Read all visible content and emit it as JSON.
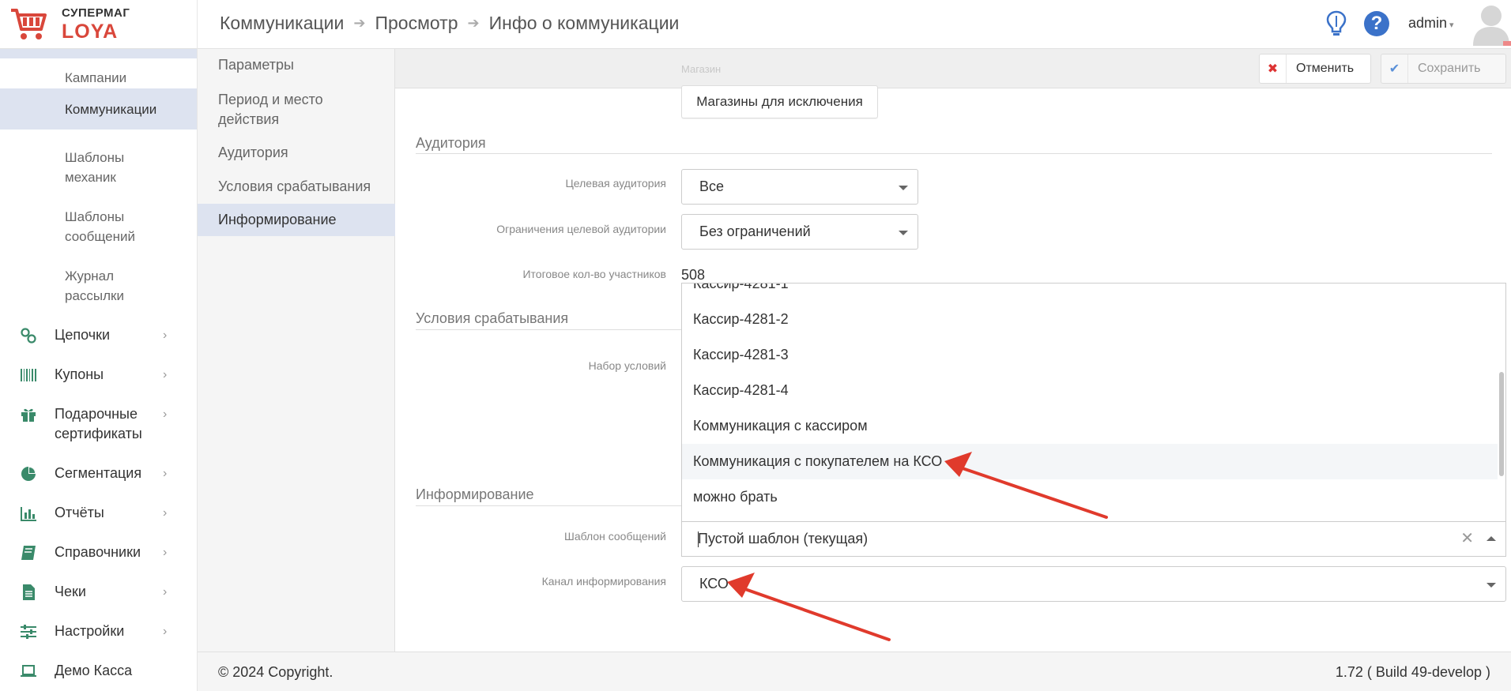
{
  "logo": {
    "top": "СУПЕРМАГ",
    "bottom": "LOYA"
  },
  "breadcrumb": {
    "items": [
      "Коммуникации",
      "Просмотр",
      "Инфо о коммуникации"
    ],
    "separator": "➔"
  },
  "header": {
    "user": "admin",
    "help_glyph": "?"
  },
  "sidebar": {
    "sub_items": [
      {
        "label": "Кампании"
      },
      {
        "label": "Коммуникации"
      },
      {
        "label": "Шаблоны механик"
      },
      {
        "label": "Шаблоны сообщений"
      },
      {
        "label": "Журнал рассылки"
      }
    ],
    "nav_items": [
      {
        "label": "Цепочки",
        "icon": "chain-icon"
      },
      {
        "label": "Купоны",
        "icon": "barcode-icon"
      },
      {
        "label": "Подарочные сертификаты",
        "icon": "gift-icon"
      },
      {
        "label": "Сегментация",
        "icon": "pie-chart-icon"
      },
      {
        "label": "Отчёты",
        "icon": "bar-chart-icon"
      },
      {
        "label": "Справочники",
        "icon": "book-icon"
      },
      {
        "label": "Чеки",
        "icon": "receipt-icon"
      },
      {
        "label": "Настройки",
        "icon": "sliders-icon"
      },
      {
        "label": "Демо Касса",
        "icon": "laptop-icon"
      }
    ],
    "chevron": "›"
  },
  "submenu": {
    "items": [
      {
        "label": "Параметры"
      },
      {
        "label": "Период и место действия"
      },
      {
        "label": "Аудитория"
      },
      {
        "label": "Условия срабатывания"
      },
      {
        "label": "Информирование"
      }
    ]
  },
  "toolbar": {
    "faded_text": "Магазин",
    "cancel_label": "Отменить",
    "save_label": "Сохранить",
    "cancel_glyph": "✖",
    "save_glyph": "✔"
  },
  "form": {
    "exclude_stores_button": "Магазины для исключения",
    "sections": {
      "audience": "Аудитория",
      "conditions": "Условия срабатывания",
      "informing": "Информирование"
    },
    "labels": {
      "target_audience": "Целевая аудитория",
      "audience_limits": "Ограничения целевой аудитории",
      "total_participants": "Итоговое кол-во участников",
      "conditions_set": "Набор условий",
      "message_template": "Шаблон сообщений",
      "channel": "Канал информирования"
    },
    "values": {
      "target_audience": "Все",
      "audience_limits": "Без ограничений",
      "total_participants": "508",
      "message_template": "Пустой шаблон (текущая)",
      "channel": "КСО"
    },
    "clear_glyph": "✕"
  },
  "dropdown": {
    "options": [
      {
        "label": "Кассир-4281-1"
      },
      {
        "label": "Кассир-4281-2"
      },
      {
        "label": "Кассир-4281-3"
      },
      {
        "label": "Кассир-4281-4"
      },
      {
        "label": "Коммуникация с кассиром"
      },
      {
        "label": "Коммуникация с покупателем на КСО",
        "highlighted": true
      },
      {
        "label": "можно брать"
      }
    ]
  },
  "footer": {
    "copyright": "© 2024 Copyright.",
    "version": "1.72 ( Build 49-develop )"
  },
  "colors": {
    "accent": "#d9473b",
    "active_bg": "#dde3f0",
    "arrow": "#e03a2c",
    "help": "#3b72c9"
  }
}
